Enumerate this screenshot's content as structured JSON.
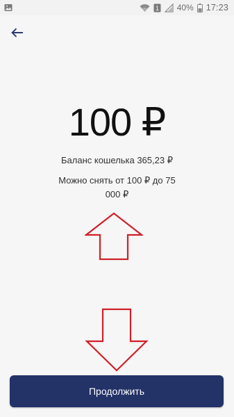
{
  "status_bar": {
    "battery": "40%",
    "time": "17:23",
    "notification_count": "1",
    "icons": [
      "gallery-icon",
      "wifi-icon",
      "sim-icon",
      "signal-icon",
      "battery-icon"
    ]
  },
  "header": {
    "back_icon": "arrow-left-icon"
  },
  "main": {
    "amount": "100 ₽",
    "balance_text": "Баланс кошелька 365,23 ₽",
    "limits_text": "Можно снять от 100 ₽ до 75 000 ₽",
    "overlay_arrows": [
      "arrow-up-icon",
      "arrow-down-icon"
    ]
  },
  "footer": {
    "continue_label": "Продолжить"
  },
  "colors": {
    "accent": "#233267",
    "back_arrow": "#2c3a6e",
    "annotation_arrow": "#d0202a",
    "background": "#f6f6f6"
  }
}
